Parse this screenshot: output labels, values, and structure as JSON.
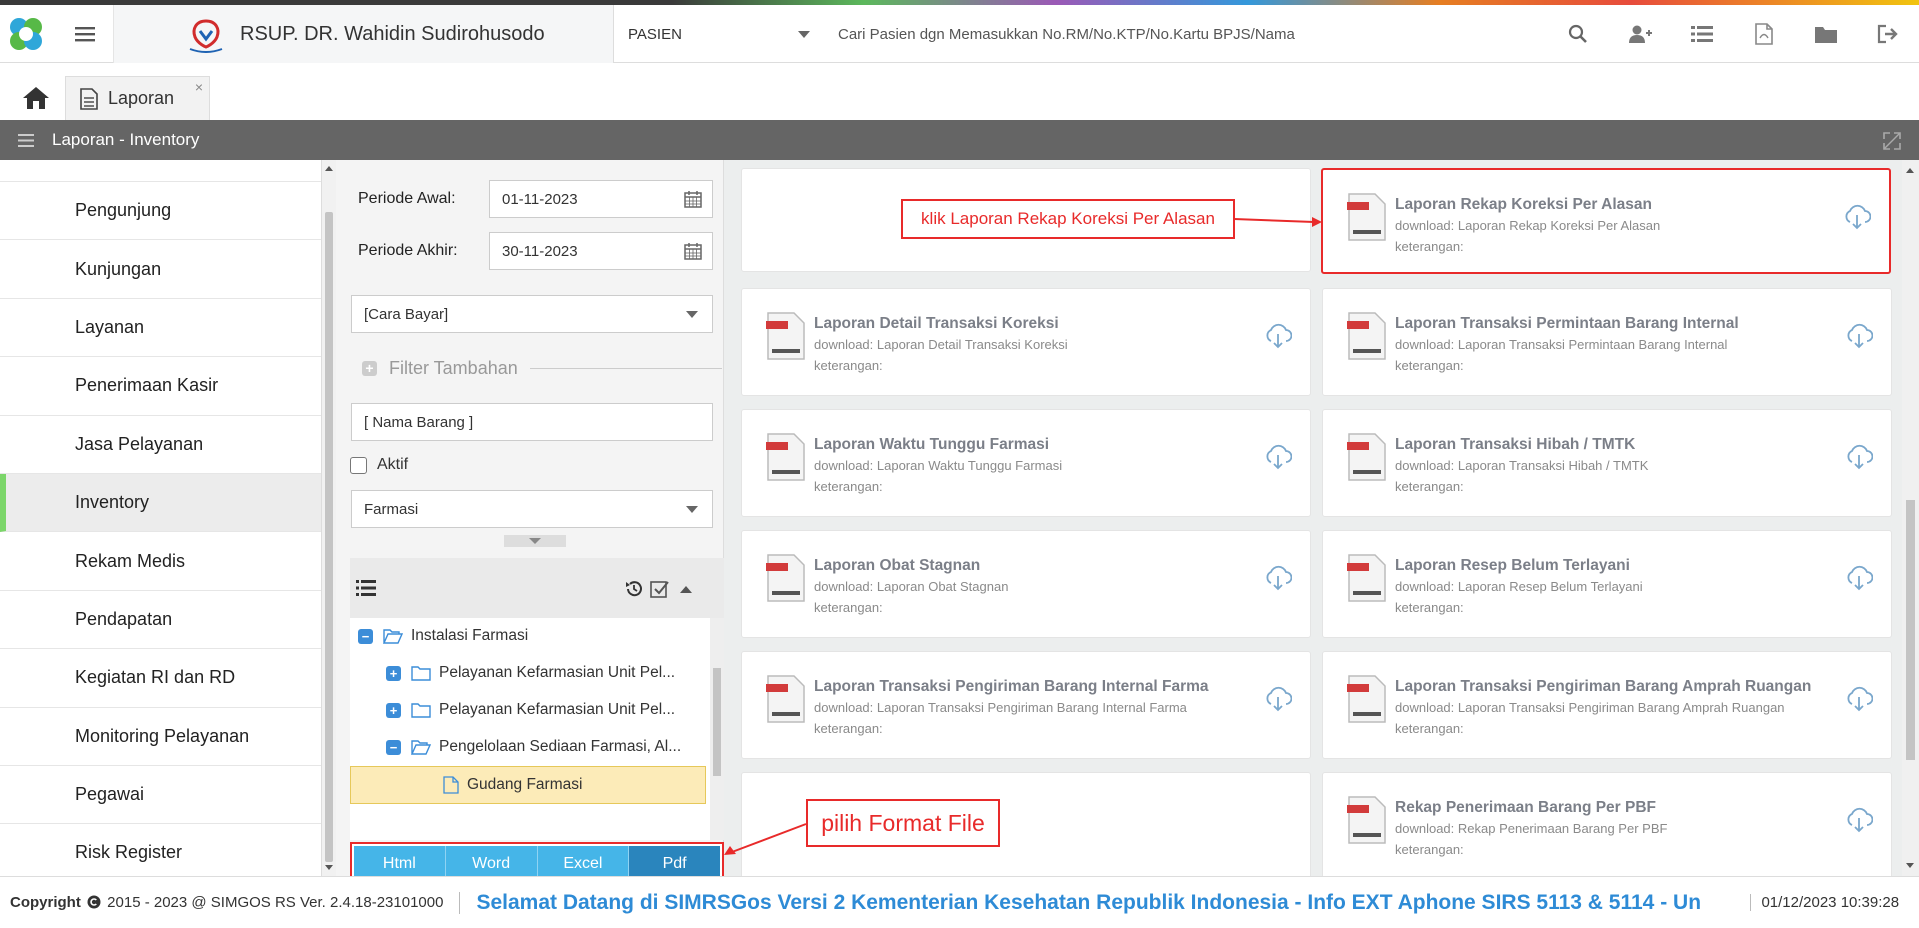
{
  "header": {
    "hospital_name": "RSUP. DR. Wahidin Sudirohusodo",
    "patient_type": "PASIEN",
    "search_placeholder": "Cari Pasien dgn Memasukkan No.RM/No.KTP/No.Kartu BPJS/Nama"
  },
  "tabs": {
    "active_label": "Laporan",
    "close_glyph": "×"
  },
  "page_title": "Laporan - Inventory",
  "sidebar": {
    "items": [
      {
        "label": "Pengunjung"
      },
      {
        "label": "Kunjungan"
      },
      {
        "label": "Layanan"
      },
      {
        "label": "Penerimaan Kasir"
      },
      {
        "label": "Jasa Pelayanan"
      },
      {
        "label": "Inventory",
        "active": true
      },
      {
        "label": "Rekam Medis"
      },
      {
        "label": "Pendapatan"
      },
      {
        "label": "Kegiatan RI dan RD"
      },
      {
        "label": "Monitoring Pelayanan"
      },
      {
        "label": "Pegawai"
      },
      {
        "label": "Risk Register"
      }
    ]
  },
  "filter": {
    "periode_awal_label": "Periode Awal:",
    "periode_awal_value": "01-11-2023",
    "periode_akhir_label": "Periode Akhir:",
    "periode_akhir_value": "30-11-2023",
    "cara_bayar": "[Cara Bayar]",
    "filter_tambahan": "Filter Tambahan",
    "nama_barang_placeholder": "[ Nama Barang ]",
    "aktif_label": "Aktif",
    "instalasi": "Farmasi"
  },
  "tree": {
    "nodes": [
      {
        "label": "Instalasi Farmasi",
        "toggle": "−"
      },
      {
        "label": "Pelayanan Kefarmasian Unit Pel...",
        "toggle": "+"
      },
      {
        "label": "Pelayanan Kefarmasian Unit Pel...",
        "toggle": "+"
      },
      {
        "label": "Pengelolaan Sediaan Farmasi, Al...",
        "toggle": "−"
      },
      {
        "label": "Gudang Farmasi",
        "selected": true
      }
    ]
  },
  "formats": [
    "Html",
    "Word",
    "Excel",
    "Pdf"
  ],
  "reports": [
    {
      "title": "Laporan Rekap Koreksi Per Alasan",
      "download": "download: Laporan Rekap Koreksi Per Alasan",
      "keterangan": "keterangan:"
    },
    {
      "title": "Laporan Detail Transaksi Koreksi",
      "download": "download: Laporan Detail Transaksi Koreksi",
      "keterangan": "keterangan:"
    },
    {
      "title": "Laporan Transaksi Permintaan Barang Internal",
      "download": "download: Laporan Transaksi Permintaan Barang Internal",
      "keterangan": "keterangan:"
    },
    {
      "title": "Laporan Waktu Tunggu Farmasi",
      "download": "download: Laporan Waktu Tunggu Farmasi",
      "keterangan": "keterangan:"
    },
    {
      "title": "Laporan Transaksi Hibah / TMTK",
      "download": "download: Laporan Transaksi Hibah / TMTK",
      "keterangan": "keterangan:"
    },
    {
      "title": "Laporan Obat Stagnan",
      "download": "download: Laporan Obat Stagnan",
      "keterangan": "keterangan:"
    },
    {
      "title": "Laporan Resep Belum Terlayani",
      "download": "download: Laporan Resep Belum Terlayani",
      "keterangan": "keterangan:"
    },
    {
      "title": "Laporan Transaksi Pengiriman Barang Internal Farma",
      "download": "download: Laporan Transaksi Pengiriman Barang Internal Farma",
      "keterangan": "keterangan:"
    },
    {
      "title": "Laporan Transaksi Pengiriman Barang Amprah Ruangan",
      "download": "download: Laporan Transaksi Pengiriman Barang Amprah Ruangan",
      "keterangan": "keterangan:"
    },
    {
      "title": "Rekap Penerimaan Barang Per PBF",
      "download": "download: Rekap Penerimaan Barang Per PBF",
      "keterangan": "keterangan:"
    }
  ],
  "annotations": {
    "callout_report": "klik Laporan Rekap Koreksi Per Alasan",
    "callout_format": "pilih Format File"
  },
  "footer": {
    "copyright_label": "Copyright",
    "copyright_text": "2015 - 2023 @ SIMGOS RS Ver. 2.4.18-23101000",
    "marquee": "Selamat Datang di SIMRSGos Versi 2 Kementerian Kesehatan Republik Indonesia - Info EXT Aphone SIRS 5113 & 5114 - Un",
    "datetime": "01/12/2023 10:39:28"
  },
  "colors": {
    "accent_red": "#e82a2a",
    "button_blue": "#45b5e8",
    "button_blue_active": "#2a85bd",
    "active_green": "#7cd66a",
    "titlebar_gray": "#656565"
  }
}
